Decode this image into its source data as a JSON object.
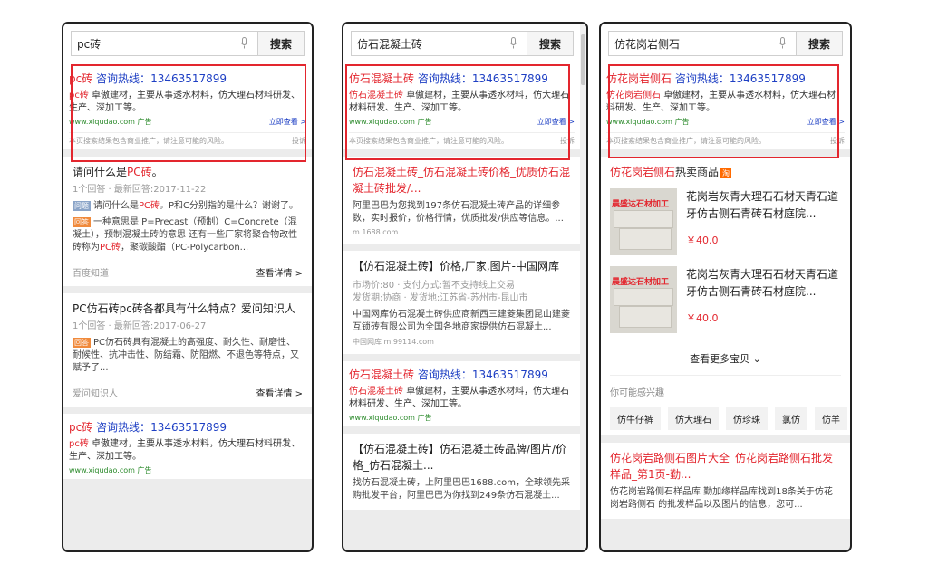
{
  "colors": {
    "accent_red": "#e3262e",
    "link_blue": "#1f40c4",
    "url_green": "#2a8a2a"
  },
  "icons": {
    "mic": "mic-icon",
    "chevron": "chevron-down-icon"
  },
  "common": {
    "search_btn": "搜索",
    "hotline": "咨询热线：",
    "phone": "13463517899",
    "ad_desc_1": "卓傲建材，主要从事透水材料，仿大理石材料研发、生产、深加工等。",
    "ad_desc_2": "卓傲建材，主要从事透水材料，仿大理石材料研发、生产、深加工等。",
    "ad_url": "www.xiqudao.com",
    "ad_label": "广告",
    "ad_go": "立即查看 >",
    "disclaimer": "本页搜索结果包含商业推广，请注意可能的风险。",
    "report": "投诉"
  },
  "panel1": {
    "query": "pc砖",
    "ad_kw": "pc砖",
    "r1": {
      "title_pre": "请问什么是",
      "title_kw": "PC砖",
      "title_post": "。",
      "meta": "1个回答 · 最新回答:2017-11-22",
      "q_tag": "问题",
      "q_pre": "请问什么是",
      "q_kw": "PC砖",
      "q_post": "。P和C分别指的是什么？谢谢了。",
      "a_tag": "回答",
      "a_pre": "一种意思是 P=Precast（预制）C=Concrete（混凝土），预制混凝土砖的意思 还有一些厂家将聚合物改性砖称为",
      "a_kw": "PC砖",
      "a_post": "，聚碳酸酯（PC-Polycarbon...",
      "src": "百度知道",
      "more": "查看详情 >"
    },
    "r2": {
      "title": "PC仿石砖pc砖各都具有什么特点？爱问知识人",
      "meta": "1个回答 · 最新回答:2017-06-27",
      "a_tag": "回答",
      "a_text": "PC仿石砖具有混凝土的高强度、耐久性、耐磨性、耐候性、抗冲击性、防结霜、防阻燃、不退色等特点，又赋予了...",
      "src": "爱问知识人",
      "more": "查看详情 >"
    }
  },
  "panel2": {
    "query": "仿石混凝土砖",
    "ad_kw": "仿石混凝土砖",
    "r1": {
      "title": "仿石混凝土砖_仿石混凝土砖价格_优质仿石混凝土砖批发/...",
      "snippet": "阿里巴巴为您找到197条仿石混凝土砖产品的详细参数，实时报价，价格行情，优质批发/供应等信息。...",
      "site": "m.1688.com"
    },
    "r2": {
      "title": "【仿石混凝土砖】价格,厂家,图片-中国网库",
      "meta1": "市场价:80 · 支付方式:暂不支持线上交易",
      "meta2": "发货期:协商 · 发货地:江苏省-苏州市-昆山市",
      "snippet": "中国网库仿石混凝土砖供应商新西三建菱集团昆山建菱互锁砖有限公司为全国各地商家提供仿石混凝土...",
      "site": "中国网库  m.99114.com"
    },
    "r3": {
      "title": "【仿石混凝土砖】仿石混凝土砖品牌/图片/价格_仿石混凝土...",
      "snippet": "找仿石混凝土砖，上阿里巴巴1688.com，全球领先采购批发平台，阿里巴巴为你找到249条仿石混凝土..."
    }
  },
  "panel3": {
    "query": "仿花岗岩侧石",
    "ad_kw": "仿花岗岩侧石",
    "goods_title_kw": "仿花岗岩侧石",
    "goods_title_post": "热卖商品",
    "taobao": "淘",
    "products": [
      {
        "name": "花岗岩灰青大理石石材天青石道牙仿古侧石青砖石材庭院...",
        "price": "￥40.0",
        "img_label": "晨盛达石材加工"
      },
      {
        "name": "花岗岩灰青大理石石材天青石道牙仿古侧石青砖石材庭院...",
        "price": "￥40.0",
        "img_label": "晨盛达石材加工"
      }
    ],
    "more_items": "查看更多宝贝",
    "interest": "你可能感兴趣",
    "chips": [
      "仿牛仔裤",
      "仿大理石",
      "仿珍珠",
      "氯仿",
      "仿羊"
    ],
    "r1": {
      "title": "仿花岗岩路侧石图片大全_仿花岗岩路侧石批发样品_第1页-勤...",
      "snippet": "仿花岗岩路侧石样品库 勤加缘样品库找到18条关于仿花岗岩路侧石 的批发样品以及图片的信息，您可..."
    }
  }
}
